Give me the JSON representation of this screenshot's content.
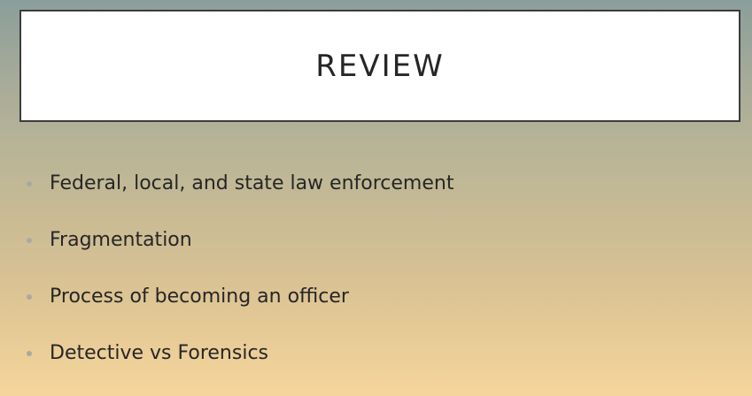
{
  "slide": {
    "title": "REVIEW",
    "bullets": [
      "Federal, local, and state law enforcement",
      "Fragmentation",
      "Process of becoming an officer",
      "Detective vs Forensics"
    ]
  },
  "colors": {
    "background_top": "#8a9e9a",
    "background_bottom": "#f6d59b",
    "title_box_fill": "#ffffff",
    "title_box_border": "#3c3c3c",
    "text": "#262626",
    "bullet_dot": "#a8aaa2"
  }
}
